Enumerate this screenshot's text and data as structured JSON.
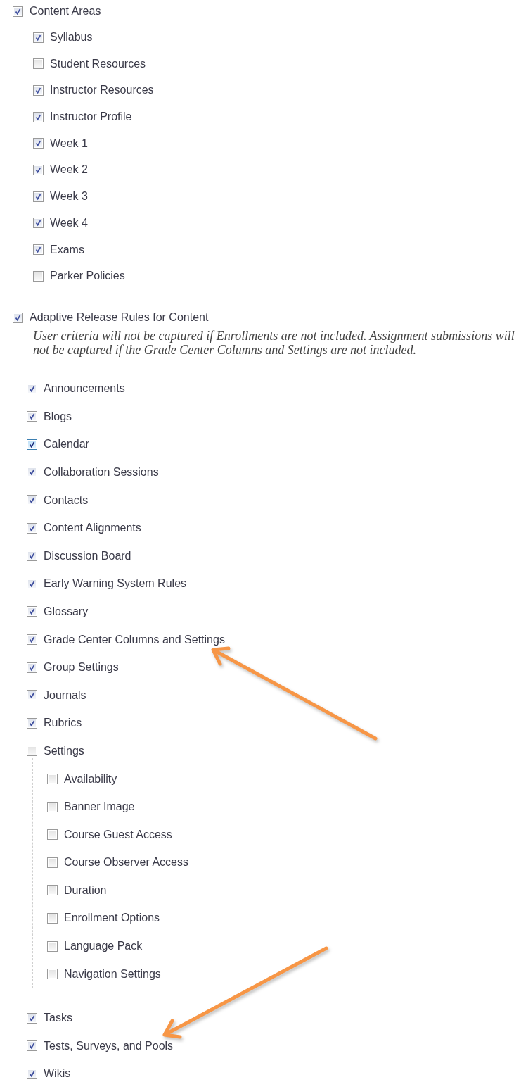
{
  "sections": [
    {
      "label": "Content Areas",
      "checked": true,
      "children": [
        {
          "label": "Syllabus",
          "checked": true
        },
        {
          "label": "Student Resources",
          "checked": false
        },
        {
          "label": "Instructor Resources",
          "checked": true
        },
        {
          "label": "Instructor Profile",
          "checked": true
        },
        {
          "label": "Week 1",
          "checked": true
        },
        {
          "label": "Week 2",
          "checked": true
        },
        {
          "label": "Week 3",
          "checked": true
        },
        {
          "label": "Week 4",
          "checked": true
        },
        {
          "label": "Exams",
          "checked": true
        },
        {
          "label": "Parker Policies",
          "checked": false
        }
      ]
    },
    {
      "label": "Adaptive Release Rules for Content",
      "checked": true,
      "note": "User criteria will not be captured if Enrollments are not included. Assignment submissions will not be captured if the Grade Center Columns and Settings are not included.",
      "items": [
        {
          "label": "Announcements",
          "checked": true,
          "focused": false
        },
        {
          "label": "Blogs",
          "checked": true,
          "focused": false
        },
        {
          "label": "Calendar",
          "checked": true,
          "focused": true
        },
        {
          "label": "Collaboration Sessions",
          "checked": true,
          "focused": false
        },
        {
          "label": "Contacts",
          "checked": true,
          "focused": false
        },
        {
          "label": "Content Alignments",
          "checked": true,
          "focused": false
        },
        {
          "label": "Discussion Board",
          "checked": true,
          "focused": false
        },
        {
          "label": "Early Warning System Rules",
          "checked": true,
          "focused": false
        },
        {
          "label": "Glossary",
          "checked": true,
          "focused": false
        },
        {
          "label": "Grade Center Columns and Settings",
          "checked": true,
          "focused": false,
          "pointer": {
            "kind": "from-lower-right"
          }
        },
        {
          "label": "Group Settings",
          "checked": true,
          "focused": false
        },
        {
          "label": "Journals",
          "checked": true,
          "focused": false
        },
        {
          "label": "Rubrics",
          "checked": true,
          "focused": false
        },
        {
          "label": "Settings",
          "checked": false,
          "focused": false,
          "children": [
            {
              "label": "Availability",
              "checked": false
            },
            {
              "label": "Banner Image",
              "checked": false
            },
            {
              "label": "Course Guest Access",
              "checked": false
            },
            {
              "label": "Course Observer Access",
              "checked": false
            },
            {
              "label": "Duration",
              "checked": false
            },
            {
              "label": "Enrollment Options",
              "checked": false
            },
            {
              "label": "Language Pack",
              "checked": false
            },
            {
              "label": "Navigation Settings",
              "checked": false
            }
          ]
        },
        {
          "label": "Tasks",
          "checked": true,
          "focused": false
        },
        {
          "label": "Tests, Surveys, and Pools",
          "checked": true,
          "focused": false,
          "pointer": {
            "kind": "from-upper-right"
          }
        },
        {
          "label": "Wikis",
          "checked": true,
          "focused": false
        }
      ]
    }
  ]
}
